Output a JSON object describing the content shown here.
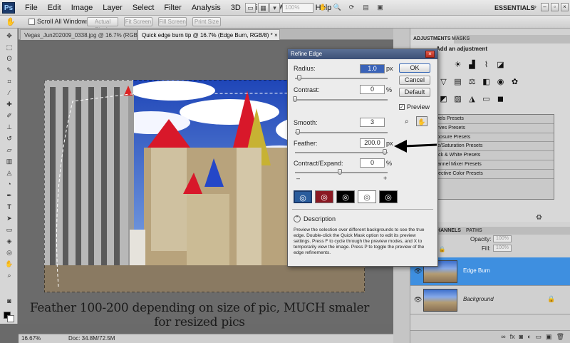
{
  "app": {
    "logo": "Ps",
    "workspace": "ESSENTIALS",
    "zoom_placeholder": "100%"
  },
  "menu": [
    "File",
    "Edit",
    "Image",
    "Layer",
    "Select",
    "Filter",
    "Analysis",
    "3D",
    "View",
    "Window",
    "Help"
  ],
  "options_bar": {
    "scroll_all": "Scroll All Windows",
    "buttons": [
      "Actual Pixels",
      "Fit Screen",
      "Fill Screen",
      "Print Size"
    ]
  },
  "documents": {
    "tabs": [
      "Vegas_Jun202009_0338.jpg @ 16.7% (RGB/8)",
      "Quick edge burn tip @ 16.7% (Edge Burn, RGB/8) *"
    ],
    "caption": "Feather 100-200 depending on size of pic, MUCH smaler for resized pics"
  },
  "status": {
    "zoom": "16.67%",
    "doc": "Doc: 34.8M/72.5M"
  },
  "adjustments": {
    "tabs": [
      "ADJUSTMENTS",
      "MASKS"
    ],
    "title": "Add an adjustment",
    "presets": [
      "Levels Presets",
      "Curves Presets",
      "Exposure Presets",
      "Hue/Saturation Presets",
      "Black & White Presets",
      "Channel Mixer Presets",
      "Selective Color Presets"
    ]
  },
  "layers": {
    "tabs": [
      "CHANNELS",
      "PATHS"
    ],
    "opacity_label": "Opacity:",
    "opacity_value": "100%",
    "fill_label": "Fill:",
    "fill_value": "100%",
    "items": [
      {
        "name": "Edge Burn"
      },
      {
        "name": "Background"
      }
    ]
  },
  "dialog": {
    "title": "Refine Edge",
    "radius": {
      "label": "Radius:",
      "value": "1.0",
      "unit": "px",
      "level": 0.05
    },
    "contrast": {
      "label": "Contrast:",
      "value": "0",
      "unit": "%",
      "level": 0.0
    },
    "smooth": {
      "label": "Smooth:",
      "value": "3",
      "unit": "",
      "level": 0.03
    },
    "feather": {
      "label": "Feather:",
      "value": "200.0",
      "unit": "px",
      "level": 1.0
    },
    "contract": {
      "label": "Contract/Expand:",
      "value": "0",
      "unit": "%",
      "level": 0.5,
      "minus": "–",
      "plus": "+"
    },
    "buttons": {
      "ok": "OK",
      "cancel": "Cancel",
      "default": "Default"
    },
    "preview": "Preview",
    "description_heading": "Description",
    "description": "Preview the selection over different backgrounds to see the true edge. Double-click the Quick Mask option to edit its preview settings. Press F to cycle through the preview modes, and X to temporarily view the image. Press P to toggle the preview of the edge refinements."
  },
  "colors": {
    "selected_layer": "#3e8fe0",
    "dialog_title": "#3b4f76",
    "arrow": "#000000"
  }
}
